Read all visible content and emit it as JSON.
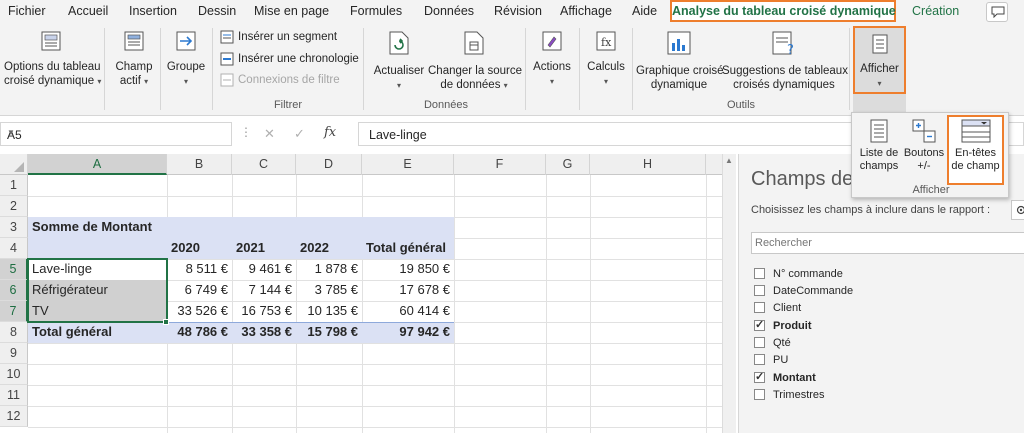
{
  "menu": {
    "items": [
      "Fichier",
      "Accueil",
      "Insertion",
      "Dessin",
      "Mise en page",
      "Formules",
      "Données",
      "Révision",
      "Affichage",
      "Aide"
    ],
    "active": "Analyse du tableau croisé dynamique",
    "extra": "Création"
  },
  "ribbon": {
    "options": [
      "Options du tableau",
      "croisé dynamique"
    ],
    "champ": [
      "Champ",
      "actif"
    ],
    "groupe": "Groupe",
    "filtrer": {
      "segment": "Insérer un segment",
      "chronologie": "Insérer une chronologie",
      "connexions": "Connexions de filtre",
      "label": "Filtrer"
    },
    "donnees": {
      "actualiser": "Actualiser",
      "changer": [
        "Changer la source",
        "de données"
      ],
      "label": "Données"
    },
    "actions": "Actions",
    "calculs": "Calculs",
    "outils": {
      "graphique": [
        "Graphique croisé",
        "dynamique"
      ],
      "suggestions": [
        "Suggestions de tableaux",
        "croisés dynamiques"
      ],
      "label": "Outils"
    },
    "afficher": "Afficher"
  },
  "afficher_panel": {
    "liste": [
      "Liste de",
      "champs"
    ],
    "boutons": [
      "Boutons",
      "+/-"
    ],
    "entetes": [
      "En-têtes",
      "de champ"
    ],
    "label": "Afficher"
  },
  "formula_bar": {
    "cell_ref": "A5",
    "content": "Lave-linge"
  },
  "sheet": {
    "columns": [
      "A",
      "B",
      "C",
      "D",
      "E",
      "F",
      "G",
      "H"
    ],
    "rows": [
      "1",
      "2",
      "3",
      "4",
      "5",
      "6",
      "7",
      "8",
      "9",
      "10",
      "11",
      "12"
    ],
    "pivot": {
      "title": "Somme de Montant",
      "years": [
        "2020",
        "2021",
        "2022",
        "Total général"
      ],
      "data": [
        {
          "label": "Lave-linge",
          "values": [
            "8 511 €",
            "9 461 €",
            "1 878 €",
            "19 850 €"
          ]
        },
        {
          "label": "Réfrigérateur",
          "values": [
            "6 749 €",
            "7 144 €",
            "3 785 €",
            "17 678 €"
          ]
        },
        {
          "label": "TV",
          "values": [
            "33 526 €",
            "16 753 €",
            "10 135 €",
            "60 414 €"
          ]
        }
      ],
      "total": {
        "label": "Total général",
        "values": [
          "48 786 €",
          "33 358 €",
          "15 798 €",
          "97 942 €"
        ]
      }
    }
  },
  "pane": {
    "title": "Champs de",
    "subtitle": "Choisissez les champs à inclure dans le rapport :",
    "search_placeholder": "Rechercher",
    "fields": [
      {
        "label": "N° commande",
        "checked": false
      },
      {
        "label": "DateCommande",
        "checked": false
      },
      {
        "label": "Client",
        "checked": false
      },
      {
        "label": "Produit",
        "checked": true
      },
      {
        "label": "Qté",
        "checked": false
      },
      {
        "label": "PU",
        "checked": false
      },
      {
        "label": "Montant",
        "checked": true
      },
      {
        "label": "Trimestres",
        "checked": false
      }
    ]
  },
  "colors": {
    "accent_green": "#217346",
    "highlight_orange": "#ee7e2d",
    "pivot_header_fill": "#dbe1f4",
    "selection_fill": "#d0d0d0"
  }
}
